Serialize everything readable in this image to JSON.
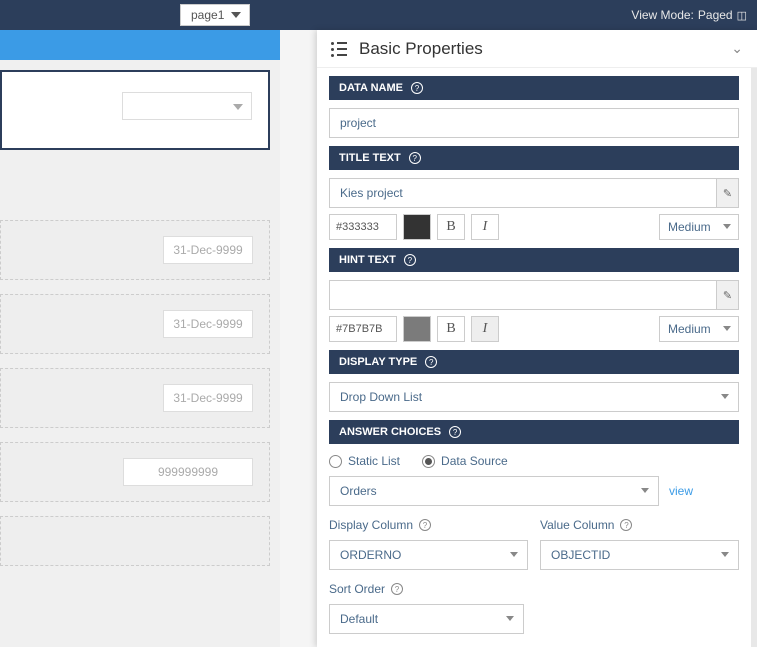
{
  "topbar": {
    "page_select": "page1",
    "view_mode_label": "View Mode:",
    "view_mode_value": "Paged"
  },
  "preview": {
    "ghost_dates": [
      "31-Dec-9999",
      "31-Dec-9999",
      "31-Dec-9999"
    ],
    "ghost_number": "999999999"
  },
  "panel": {
    "title": "Basic Properties",
    "data_name": {
      "label": "DATA NAME",
      "value": "project"
    },
    "title_text": {
      "label": "TITLE TEXT",
      "value": "Kies project",
      "color": "#333333",
      "size": "Medium"
    },
    "hint_text": {
      "label": "HINT TEXT",
      "value": "",
      "color": "#7B7B7B",
      "size": "Medium"
    },
    "display_type": {
      "label": "DISPLAY TYPE",
      "value": "Drop Down List"
    },
    "answer_choices": {
      "label": "ANSWER CHOICES",
      "static_label": "Static List",
      "source_label": "Data Source",
      "selected": "source",
      "source_value": "Orders",
      "view_link": "view",
      "display_column": {
        "label": "Display Column",
        "value": "ORDERNO"
      },
      "value_column": {
        "label": "Value Column",
        "value": "OBJECTID"
      },
      "sort_order": {
        "label": "Sort Order",
        "value": "Default"
      }
    }
  }
}
